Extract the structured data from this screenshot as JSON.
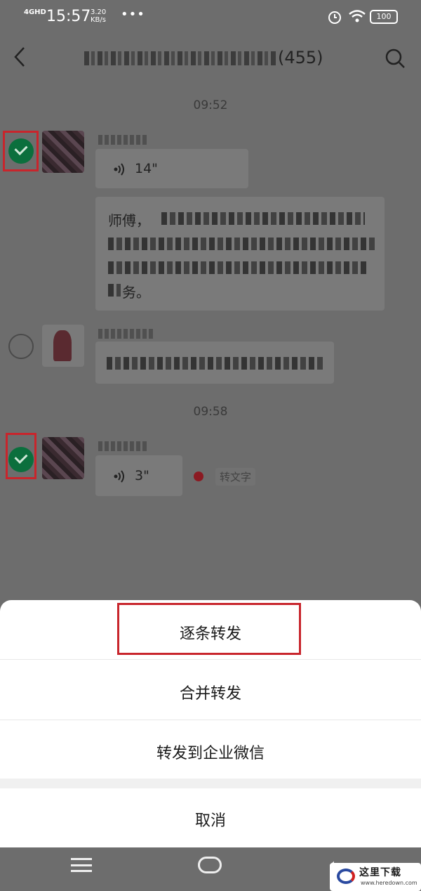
{
  "status_bar": {
    "network": "4GHD",
    "time": "15:57",
    "speed_value": "3.20",
    "speed_unit": "KB/s",
    "more": "•••",
    "battery": "100"
  },
  "header": {
    "back_icon": "chevron-left-icon",
    "title_count": "(455)",
    "search_icon": "search-icon"
  },
  "timestamps": [
    "09:52",
    "09:58"
  ],
  "messages": [
    {
      "selected": true,
      "voice_duration": "14\"",
      "text_prefix": "师傅，",
      "text_suffix": "务。"
    },
    {
      "selected": false
    },
    {
      "selected": true,
      "voice_duration": "3\"",
      "transcribe_label": "转文字"
    }
  ],
  "action_sheet": {
    "forward_one_by_one": "逐条转发",
    "merge_forward": "合并转发",
    "forward_to_wecom": "转发到企业微信",
    "cancel": "取消"
  },
  "nav_bar": {
    "menu_icon": "menu-icon",
    "home_icon": "home-icon",
    "back_icon": "back-icon"
  },
  "watermark": {
    "cn": "这里下载",
    "en": "www.heredown.com"
  },
  "colors": {
    "highlight": "#c8252c",
    "check_green": "#0b6f3d",
    "overlay": "#6d6d6d"
  }
}
